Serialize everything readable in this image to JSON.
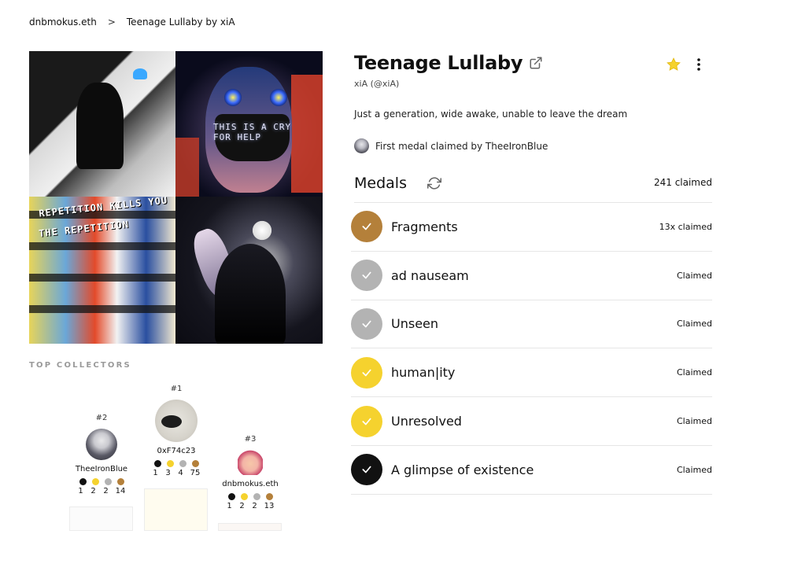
{
  "breadcrumb": {
    "root": "dnbmokus.eth",
    "separator": ">",
    "current": "Teenage Lullaby by xiA"
  },
  "artwork": {
    "overlay_text_1": "THIS IS A CRY",
    "overlay_text_2": "FOR HELP",
    "overlay_text_3": "REPETITION KILLS YOU",
    "overlay_text_4": "THE REPETITION"
  },
  "collection": {
    "title": "Teenage Lullaby",
    "artist": "xiA (@xiA)",
    "description": "Just a generation, wide awake, unable to leave the dream",
    "first_medal": "First medal claimed by TheeIronBlue"
  },
  "colors": {
    "black": "#111111",
    "gold": "#f5d22e",
    "silver": "#b3b3b3",
    "bronze": "#b4803a"
  },
  "medals_header": {
    "label": "Medals",
    "claimed": "241 claimed"
  },
  "medals": [
    {
      "name": "Fragments",
      "status": "13x claimed",
      "tier": "bronze"
    },
    {
      "name": "ad nauseam",
      "status": "Claimed",
      "tier": "silver"
    },
    {
      "name": "Unseen",
      "status": "Claimed",
      "tier": "silver"
    },
    {
      "name": "human|ity",
      "status": "Claimed",
      "tier": "gold"
    },
    {
      "name": "Unresolved",
      "status": "Claimed",
      "tier": "gold"
    },
    {
      "name": "A glimpse of existence",
      "status": "Claimed",
      "tier": "black"
    }
  ],
  "top_collectors": {
    "title": "TOP COLLECTORS",
    "first": {
      "rank": "#1",
      "name": "0xF74c23",
      "counts": [
        "1",
        "3",
        "4",
        "75"
      ]
    },
    "second": {
      "rank": "#2",
      "name": "TheeIronBlue",
      "counts": [
        "1",
        "2",
        "2",
        "14"
      ]
    },
    "third": {
      "rank": "#3",
      "name": "dnbmokus.eth",
      "counts": [
        "1",
        "2",
        "2",
        "13"
      ]
    }
  },
  "icons": {
    "external_link": "external-link-icon",
    "favorite": "star-icon",
    "more": "kebab-menu-icon",
    "refresh": "refresh-icon",
    "check": "check-icon"
  }
}
